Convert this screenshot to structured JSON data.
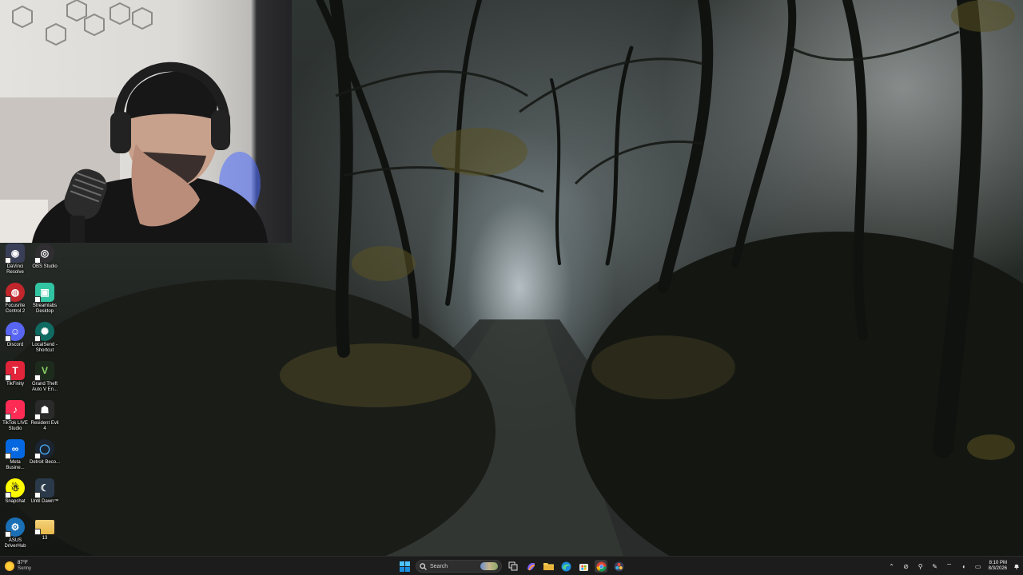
{
  "desktop": {
    "icons": [
      {
        "label": "DaVinci Resolve",
        "icon": "davinci-resolve-icon",
        "color": "#3a3f58"
      },
      {
        "label": "OBS Studio",
        "icon": "obs-studio-icon",
        "color": "#302e31"
      },
      {
        "label": "Focusrite Control 2",
        "icon": "focusrite-control-icon",
        "color": "#c0262b"
      },
      {
        "label": "Streamlabs Desktop",
        "icon": "streamlabs-icon",
        "color": "#31c3a2"
      },
      {
        "label": "Discord",
        "icon": "discord-icon",
        "color": "#5865f2"
      },
      {
        "label": "LocalSend - Shortcut",
        "icon": "localsend-icon",
        "color": "#0f6b62"
      },
      {
        "label": "TikFinity",
        "icon": "tikfinity-icon",
        "color": "#e2243b"
      },
      {
        "label": "Grand Theft Auto V En...",
        "icon": "gta-v-icon",
        "color": "#1d2b1c"
      },
      {
        "label": "TikTok LIVE Studio",
        "icon": "tiktok-live-studio-icon",
        "color": "#fe2c55"
      },
      {
        "label": "Resident Evil 4",
        "icon": "resident-evil-4-icon",
        "color": "#2a2a2a"
      },
      {
        "label": "Meta Busine...",
        "icon": "meta-business-icon",
        "color": "#0668e1"
      },
      {
        "label": "Detroit Beco...",
        "icon": "detroit-become-human-icon",
        "color": "#1b2431"
      },
      {
        "label": "Snapchat",
        "icon": "snapchat-icon",
        "color": "#fffc00"
      },
      {
        "label": "Until Dawn™",
        "icon": "until-dawn-icon",
        "color": "#2b3a4a"
      },
      {
        "label": "ASUS DriverHub",
        "icon": "asus-driverhub-icon",
        "color": "#1a6fb5"
      },
      {
        "label": "13",
        "icon": "folder-icon",
        "color": "#e8b84a"
      }
    ]
  },
  "taskbar": {
    "weather_temp": "87°F",
    "weather_condition": "Sunny",
    "search_placeholder": "Search",
    "pinned": [
      {
        "name": "start-button",
        "icon": "windows-icon"
      },
      {
        "name": "task-view-button",
        "icon": "task-view-icon"
      },
      {
        "name": "copilot-button",
        "icon": "copilot-icon"
      },
      {
        "name": "file-explorer-button",
        "icon": "folder-icon"
      },
      {
        "name": "edge-button",
        "icon": "edge-icon"
      },
      {
        "name": "store-button",
        "icon": "store-icon"
      },
      {
        "name": "chrome-button",
        "icon": "chrome-icon"
      },
      {
        "name": "davinci-taskbar-button",
        "icon": "davinci-resolve-icon"
      }
    ],
    "clock_time": "8:10 PM",
    "clock_date": "8/3/2026"
  },
  "colors": {
    "taskbar_bg": "#1c1c1c",
    "accent": "#0078d4"
  }
}
